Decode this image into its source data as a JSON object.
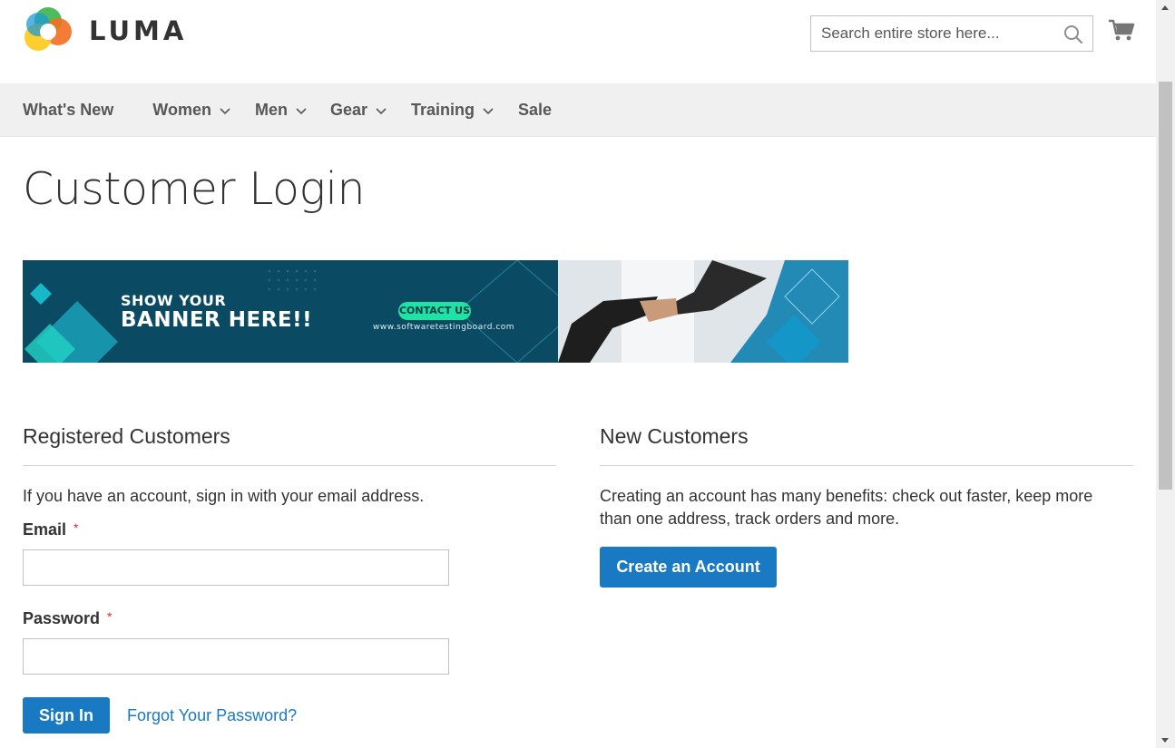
{
  "header": {
    "logo_text": "LUMA",
    "search_placeholder": "Search entire store here..."
  },
  "nav": {
    "items": [
      {
        "label": "What's New",
        "has_dropdown": false
      },
      {
        "label": "Women",
        "has_dropdown": true
      },
      {
        "label": "Men",
        "has_dropdown": true
      },
      {
        "label": "Gear",
        "has_dropdown": true
      },
      {
        "label": "Training",
        "has_dropdown": true
      },
      {
        "label": "Sale",
        "has_dropdown": false
      }
    ]
  },
  "page": {
    "title": "Customer Login"
  },
  "banner": {
    "line1": "SHOW YOUR",
    "line2": "BANNER HERE!!",
    "cta": "CONTACT US",
    "url": "www.softwaretestingboard.com"
  },
  "registered": {
    "title": "Registered Customers",
    "intro": "If you have an account, sign in with your email address.",
    "email_label": "Email",
    "password_label": "Password",
    "required_mark": "*",
    "sign_in_label": "Sign In",
    "forgot_label": "Forgot Your Password?"
  },
  "new_customers": {
    "title": "New Customers",
    "intro": "Creating an account has many benefits: check out faster, keep more than one address, track orders and more.",
    "create_label": "Create an Account"
  },
  "colors": {
    "primary": "#1979c3",
    "nav_bg": "#f0f0f0",
    "required": "#e02b27",
    "banner_bg": "#0b4a63"
  }
}
